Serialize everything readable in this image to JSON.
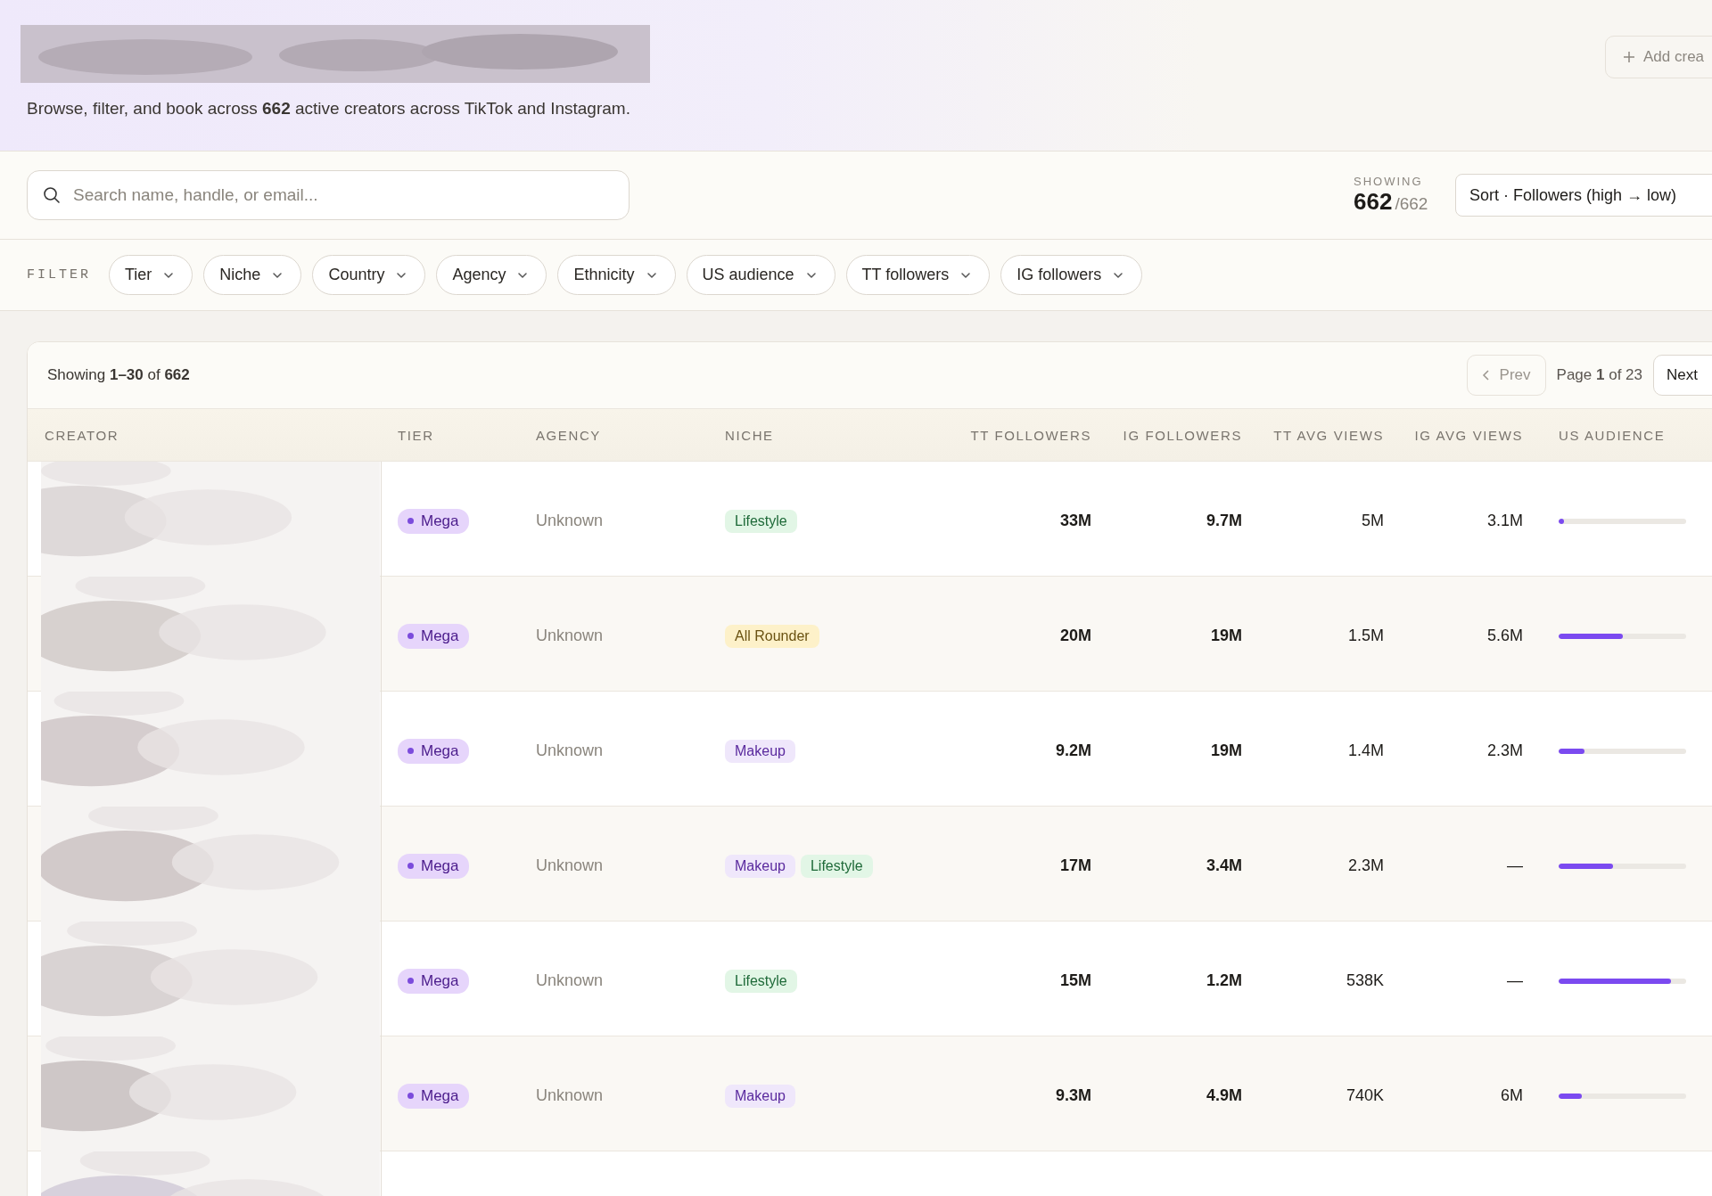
{
  "header": {
    "subtitle": "Browse, filter, and book across **662** active creators across TikTok and Instagram.",
    "add_button": "Add crea"
  },
  "search": {
    "placeholder": "Search name, handle, or email..."
  },
  "showing": {
    "label": "SHOWING",
    "count": "662",
    "total": "/662"
  },
  "sort": {
    "value": "Sort · Followers (high → low)"
  },
  "filter": {
    "label": "FILTER",
    "chips": [
      "Tier",
      "Niche",
      "Country",
      "Agency",
      "Ethnicity",
      "US audience",
      "TT followers",
      "IG followers"
    ]
  },
  "table": {
    "summary": "Showing **1–30** of **662**",
    "pagination": {
      "prev": "Prev",
      "page": "Page **1** of 23",
      "next": "Next"
    },
    "columns": [
      "CREATOR",
      "TIER",
      "AGENCY",
      "NICHE",
      "TT FOLLOWERS",
      "IG FOLLOWERS",
      "TT AVG VIEWS",
      "IG AVG VIEWS",
      "US AUDIENCE"
    ],
    "rows": [
      {
        "tier": "Mega",
        "agency": "Unknown",
        "niches": [
          {
            "label": "Lifestyle",
            "color": "#e2f6e6"
          }
        ],
        "tt_followers": "33M",
        "ig_followers": "9.7M",
        "tt_avg_views": "5M",
        "ig_avg_views": "3.1M",
        "level": 0.04
      },
      {
        "tier": "Mega",
        "agency": "Unknown",
        "niches": [
          {
            "label": "All Rounder",
            "color": "#fdf1c9"
          }
        ],
        "tt_followers": "20M",
        "ig_followers": "19M",
        "tt_avg_views": "1.5M",
        "ig_avg_views": "5.6M",
        "level": 0.5
      },
      {
        "tier": "Mega",
        "agency": "Unknown",
        "niches": [
          {
            "label": "Makeup",
            "color": "#efe7fb"
          }
        ],
        "tt_followers": "9.2M",
        "ig_followers": "19M",
        "tt_avg_views": "1.4M",
        "ig_avg_views": "2.3M",
        "level": 0.2
      },
      {
        "tier": "Mega",
        "agency": "Unknown",
        "niches": [
          {
            "label": "Makeup",
            "color": "#efe7fb"
          },
          {
            "label": "Lifestyle",
            "color": "#e2f6e6"
          }
        ],
        "tt_followers": "17M",
        "ig_followers": "3.4M",
        "tt_avg_views": "2.3M",
        "ig_avg_views": "—",
        "level": 0.43
      },
      {
        "tier": "Mega",
        "agency": "Unknown",
        "niches": [
          {
            "label": "Lifestyle",
            "color": "#e2f6e6"
          }
        ],
        "tt_followers": "15M",
        "ig_followers": "1.2M",
        "tt_avg_views": "538K",
        "ig_avg_views": "—",
        "level": 0.88
      },
      {
        "tier": "Mega",
        "agency": "Unknown",
        "niches": [
          {
            "label": "Makeup",
            "color": "#efe7fb"
          }
        ],
        "tt_followers": "9.3M",
        "ig_followers": "4.9M",
        "tt_avg_views": "740K",
        "ig_avg_views": "6M",
        "level": 0.18
      }
    ]
  }
}
